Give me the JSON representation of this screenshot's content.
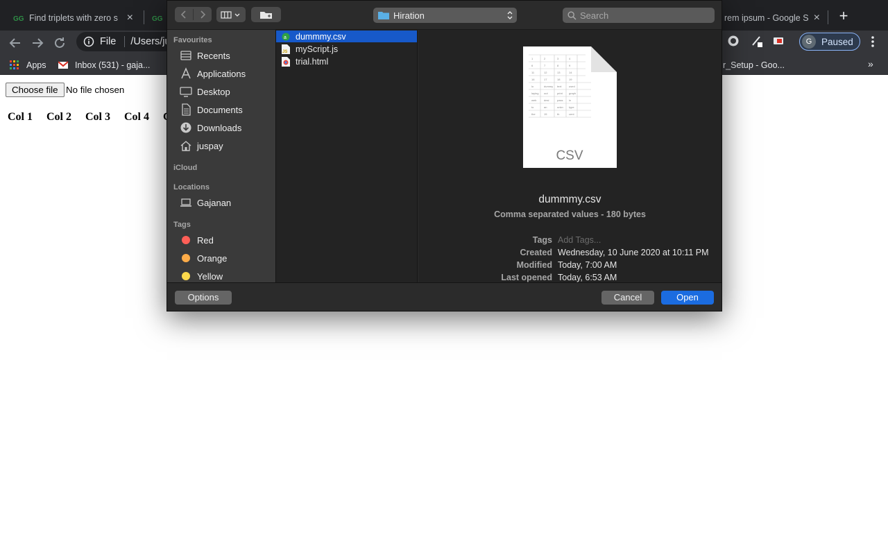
{
  "browser": {
    "tabs": [
      {
        "title": "Find triplets with zero s"
      },
      {
        "title": ""
      },
      {
        "title": "rem ipsum - Google S"
      }
    ],
    "address": {
      "scheme_label": "File",
      "url": "/Users/ju"
    },
    "profile": {
      "initial": "G",
      "status": "Paused"
    },
    "bookmarks": {
      "apps_label": "Apps",
      "inbox_label": "Inbox (531) - gaja...",
      "setup_label": "r_Setup - Goo...",
      "more_label": "»"
    }
  },
  "page": {
    "file_button_label": "Choose file",
    "file_status": "No file chosen",
    "columns": [
      "Col 1",
      "Col 2",
      "Col 3",
      "Col 4",
      "C"
    ]
  },
  "dialog": {
    "location": "Hiration",
    "search_placeholder": "Search",
    "sidebar": {
      "favourites_header": "Favourites",
      "favourites": [
        "Recents",
        "Applications",
        "Desktop",
        "Documents",
        "Downloads",
        "juspay"
      ],
      "icloud_header": "iCloud",
      "locations_header": "Locations",
      "locations": [
        "Gajanan"
      ],
      "tags_header": "Tags",
      "tags": [
        {
          "label": "Red",
          "color": "#ff5f57"
        },
        {
          "label": "Orange",
          "color": "#fdac48"
        },
        {
          "label": "Yellow",
          "color": "#fcd84b"
        }
      ]
    },
    "files": [
      {
        "name": "dummmy.csv",
        "selected": true
      },
      {
        "name": "myScript.js",
        "selected": false
      },
      {
        "name": "trial.html",
        "selected": false
      }
    ],
    "preview": {
      "doc_label": "CSV",
      "name": "dummmy.csv",
      "kind": "Comma separated values - 180 bytes",
      "meta": [
        {
          "key": "Tags",
          "value": "Add Tags..."
        },
        {
          "key": "Created",
          "value": "Wednesday, 10 June 2020 at 10:11 PM"
        },
        {
          "key": "Modified",
          "value": "Today, 7:00 AM"
        },
        {
          "key": "Last opened",
          "value": "Today, 6:53 AM"
        }
      ]
    },
    "buttons": {
      "options": "Options",
      "cancel": "Cancel",
      "open": "Open"
    },
    "accent": "#1b6ce0"
  }
}
